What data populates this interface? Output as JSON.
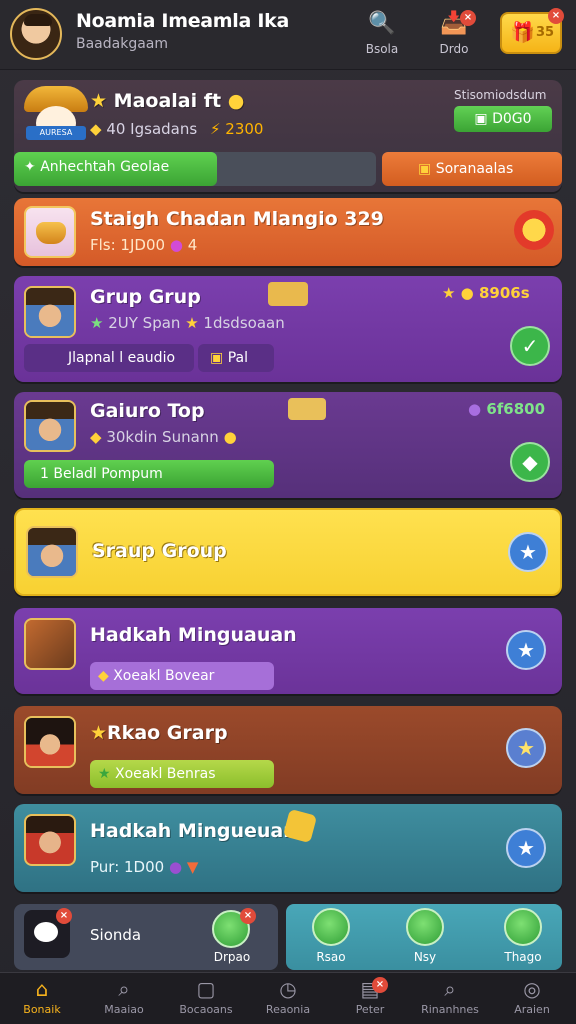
{
  "header": {
    "title": "Noamia Imeamla Ika",
    "subtitle": "Baadakgaam",
    "search_label": "Bsola",
    "inbox_label": "Drdo",
    "coin_value": "35"
  },
  "featured": {
    "title": "Maoalai ft",
    "subtitle": "40 Igsadans",
    "amount": "2300",
    "top_label": "Stisomiodsdum",
    "top_value": "D0G0",
    "progress_label": "Anhechtah Geolae",
    "progress_percent": 56,
    "right_button": "Soranaalas",
    "mascot_ribbon": "AURESA"
  },
  "cards": [
    {
      "title": "Staigh Chadan Mlangio 329",
      "subtitle": "Fls: 1JD00",
      "meta": "4"
    },
    {
      "title": "Grup Grup",
      "subtitle": "2UY Span",
      "meta": "1dsdsoaan",
      "value": "8906s",
      "pill": "Jlapnal l eaudio",
      "pill2": "Pal"
    },
    {
      "title": "Gaiuro Top",
      "subtitle": "30kdin Sunann",
      "value": "6f6800",
      "bar": "1 Beladl Pompum"
    },
    {
      "title": "Sraup Group"
    },
    {
      "title": "Hadkah Minguauan",
      "pill": "Xoeakl Bovear"
    },
    {
      "title": "Rkao Grarp",
      "pill": "Xoeakl Benras"
    },
    {
      "title": "Hadkah Mingueuan",
      "subtitle": "Pur: 1D00"
    }
  ],
  "bottom": {
    "left_label": "Sionda",
    "left_sub": "Drpao",
    "right_items": [
      "Rsao",
      "Nsy",
      "Thago"
    ]
  },
  "nav": [
    {
      "label": "Bonaik",
      "icon": "home-icon"
    },
    {
      "label": "Maaiao",
      "icon": "search-icon"
    },
    {
      "label": "Bocaoans",
      "icon": "square-icon"
    },
    {
      "label": "Reaonia",
      "icon": "clock-icon"
    },
    {
      "label": "Peter",
      "icon": "document-icon"
    },
    {
      "label": "Rinanhnes",
      "icon": "magnifier-icon"
    },
    {
      "label": "Araien",
      "icon": "compass-icon"
    }
  ],
  "colors": {
    "accent": "#f6b21d",
    "purple": "#7b3fae",
    "orange": "#e87638",
    "yellow": "#ffe14f",
    "teal": "#3f8e9f",
    "brown": "#9b4a2b",
    "green": "#3ba434",
    "blue": "#3e7fd6"
  }
}
